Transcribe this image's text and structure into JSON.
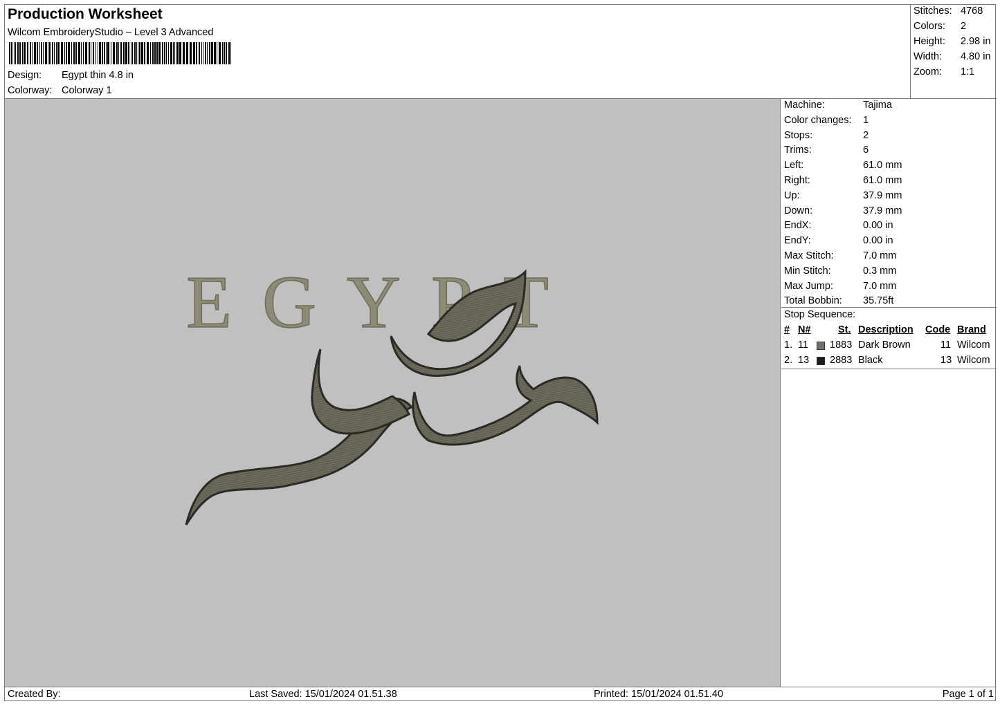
{
  "header": {
    "title": "Production Worksheet",
    "subtitle": "Wilcom EmbroideryStudio – Level 3 Advanced",
    "design_label": "Design:",
    "design_value": "Egypt thin 4.8 in",
    "colorway_label": "Colorway:",
    "colorway_value": "Colorway 1"
  },
  "summary": {
    "stitches_label": "Stitches:",
    "stitches": "4768",
    "colors_label": "Colors:",
    "colors": "2",
    "height_label": "Height:",
    "height": "2.98 in",
    "width_label": "Width:",
    "width": "4.80 in",
    "zoom_label": "Zoom:",
    "zoom": "1:1"
  },
  "design": {
    "text": "EGYPT",
    "thread_colors": {
      "dark_brown": "#6e6a5c",
      "black": "#3b3a33",
      "text": "#8d8a75",
      "background": "#c0c0c0"
    }
  },
  "machine": [
    {
      "label": "Machine:",
      "value": "Tajima"
    },
    {
      "label": "Color changes:",
      "value": "1"
    },
    {
      "label": "Stops:",
      "value": "2"
    },
    {
      "label": "Trims:",
      "value": "6"
    },
    {
      "label": "Left:",
      "value": "61.0 mm"
    },
    {
      "label": "Right:",
      "value": "61.0 mm"
    },
    {
      "label": "Up:",
      "value": "37.9 mm"
    },
    {
      "label": "Down:",
      "value": "37.9 mm"
    },
    {
      "label": "EndX:",
      "value": "0.00 in"
    },
    {
      "label": "EndY:",
      "value": "0.00 in"
    },
    {
      "label": "Max Stitch:",
      "value": "7.0 mm"
    },
    {
      "label": "Min Stitch:",
      "value": "0.3 mm"
    },
    {
      "label": "Max Jump:",
      "value": "7.0 mm"
    },
    {
      "label": "Total Bobbin:",
      "value": "35.75ft"
    }
  ],
  "stop_sequence": {
    "title": "Stop Sequence:",
    "headers": {
      "num": "#",
      "n": "N#",
      "st": "St.",
      "description": "Description",
      "code": "Code",
      "brand": "Brand"
    },
    "rows": [
      {
        "num": "1.",
        "n": "11",
        "swatch": "#76706a",
        "st": "1883",
        "description": "Dark Brown",
        "code": "11",
        "brand": "Wilcom"
      },
      {
        "num": "2.",
        "n": "13",
        "swatch": "#1e1c1a",
        "st": "2883",
        "description": "Black",
        "code": "13",
        "brand": "Wilcom"
      }
    ]
  },
  "footer": {
    "created_by": "Created By:",
    "last_saved": "Last Saved: 15/01/2024 01.51.38",
    "printed": "Printed: 15/01/2024 01.51.40",
    "page": "Page 1 of 1"
  }
}
